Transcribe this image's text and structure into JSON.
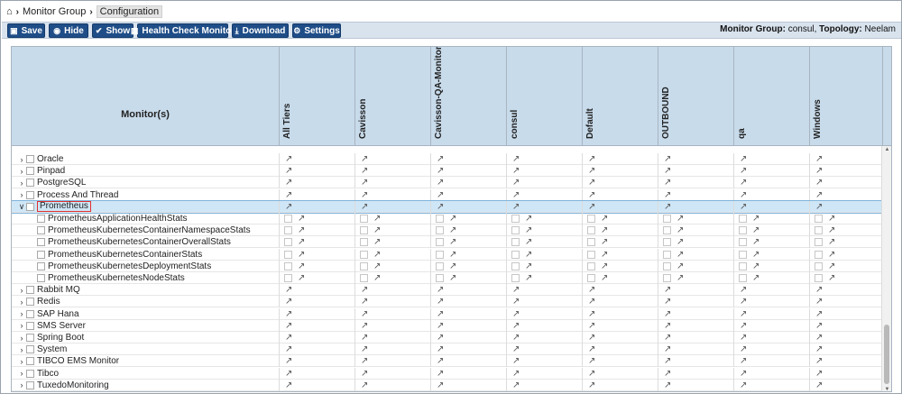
{
  "breadcrumb": {
    "home_icon": "home-icon",
    "items": [
      "Monitor Group",
      "Configuration"
    ]
  },
  "toolbar": {
    "buttons": [
      {
        "label": "Save",
        "icon": "save-icon"
      },
      {
        "label": "Hide",
        "icon": "eye-icon"
      },
      {
        "label": "Show",
        "icon": "check-icon"
      },
      {
        "label": "Health Check Monitor",
        "icon": "monitor-icon"
      },
      {
        "label": "Download",
        "icon": "download-icon"
      },
      {
        "label": "Settings",
        "icon": "gear-icon"
      }
    ],
    "info_group_label": "Monitor Group:",
    "info_group_value": "consul,",
    "info_topology_label": "Topology:",
    "info_topology_value": "Neelam"
  },
  "grid": {
    "monitor_header": "Monitor(s)",
    "columns": [
      "All Tiers",
      "Cavisson",
      "Cavisson-QA-Monitor",
      "consul",
      "Default",
      "OUTBOUND",
      "qa",
      "Windows"
    ],
    "rows": [
      {
        "name": "Oracle",
        "type": "parent"
      },
      {
        "name": "Pinpad",
        "type": "parent"
      },
      {
        "name": "PostgreSQL",
        "type": "parent"
      },
      {
        "name": "Process And Thread",
        "type": "parent"
      },
      {
        "name": "Prometheus",
        "type": "expanded"
      },
      {
        "name": "PrometheusApplicationHealthStats",
        "type": "child"
      },
      {
        "name": "PrometheusKubernetesContainerNamespaceStats",
        "type": "child"
      },
      {
        "name": "PrometheusKubernetesContainerOverallStats",
        "type": "child"
      },
      {
        "name": "PrometheusKubernetesContainerStats",
        "type": "child"
      },
      {
        "name": "PrometheusKubernetesDeploymentStats",
        "type": "child"
      },
      {
        "name": "PrometheusKubernetesNodeStats",
        "type": "child"
      },
      {
        "name": "Rabbit MQ",
        "type": "parent"
      },
      {
        "name": "Redis",
        "type": "parent"
      },
      {
        "name": "SAP Hana",
        "type": "parent"
      },
      {
        "name": "SMS Server",
        "type": "parent"
      },
      {
        "name": "Spring Boot",
        "type": "parent"
      },
      {
        "name": "System",
        "type": "parent"
      },
      {
        "name": "TIBCO EMS Monitor",
        "type": "parent"
      },
      {
        "name": "Tibco",
        "type": "parent"
      },
      {
        "name": "TuxedoMonitoring",
        "type": "parent"
      }
    ]
  },
  "colors": {
    "button_bg": "#1f4d87",
    "header_bg": "#c8dbeb",
    "selected_row": "#cfe6f6",
    "highlight_border": "#e0312f"
  }
}
